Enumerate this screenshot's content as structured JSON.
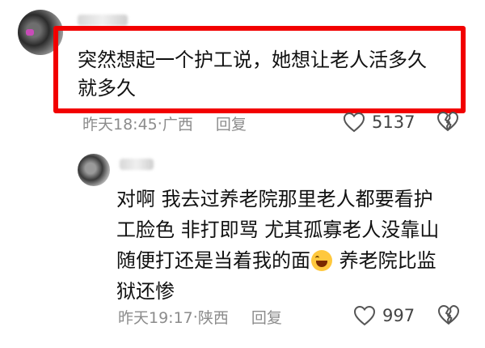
{
  "comment": {
    "text_line1": "突然想起一个护工说，她想让老人活多久",
    "text_line2": "就多久",
    "time": "昨天18:45",
    "separator": " · ",
    "location": "广西",
    "reply_label": "回复",
    "likes": "5137"
  },
  "reply": {
    "line1": "对啊 我去过养老院那里老人都要看护",
    "line2": "工脸色 非打即骂 尤其孤寡老人没靠山",
    "line3_a": "随便打还是当着我的面",
    "line3_b": " 养老院比监",
    "line4": "狱还惨",
    "time": "昨天19:17",
    "separator": " · ",
    "location": "陕西",
    "reply_label": "回复",
    "likes": "997"
  },
  "icons": {
    "like": "heart-outline-icon",
    "dislike": "broken-heart-icon",
    "emoji": "rofl-emoji-icon"
  },
  "colors": {
    "highlight": "#f20000",
    "meta": "#8c8c8c"
  }
}
